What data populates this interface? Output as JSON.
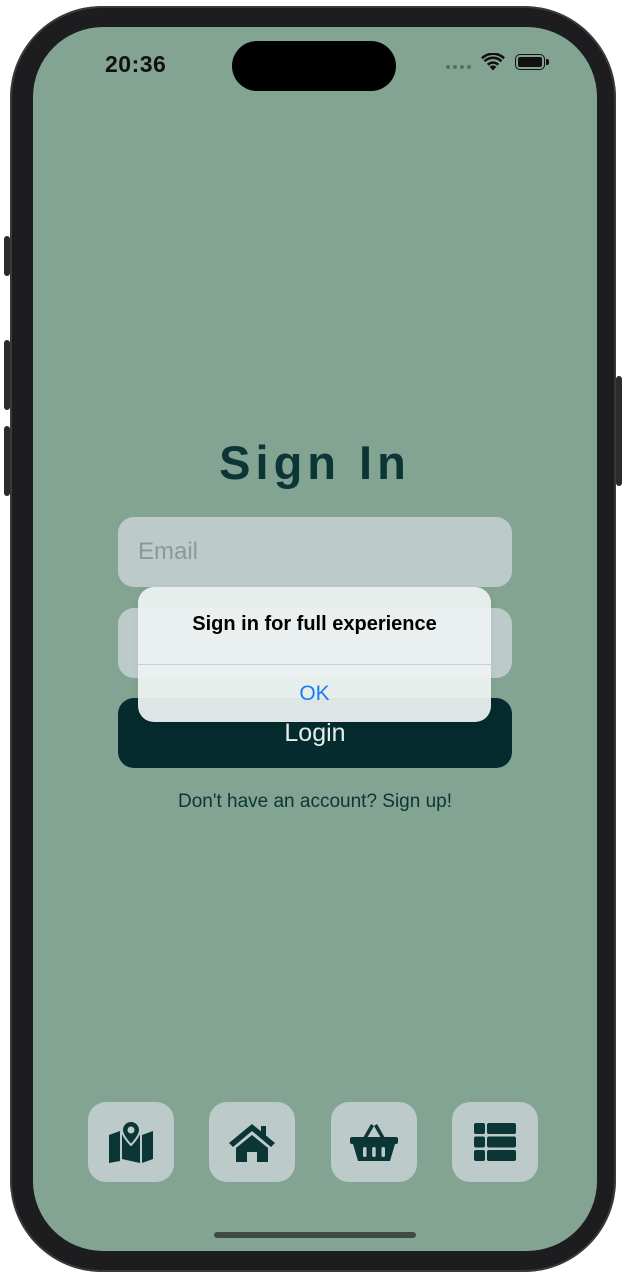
{
  "status_bar": {
    "time": "20:36"
  },
  "sign_in": {
    "title": "Sign In",
    "email_placeholder": "Email",
    "password_placeholder": "",
    "login_label": "Login",
    "signup_text": "Don't have an account? Sign up!"
  },
  "alert": {
    "message": "Sign in for full experience",
    "ok_label": "OK"
  },
  "tab_bar": {
    "items": [
      {
        "icon": "map-icon"
      },
      {
        "icon": "home-icon"
      },
      {
        "icon": "basket-icon"
      },
      {
        "icon": "list-icon"
      }
    ]
  },
  "colors": {
    "background": "#83a492",
    "primary_dark": "#052b2e",
    "field_bg": "#bccbca",
    "accent_link": "#1a7cf3"
  }
}
